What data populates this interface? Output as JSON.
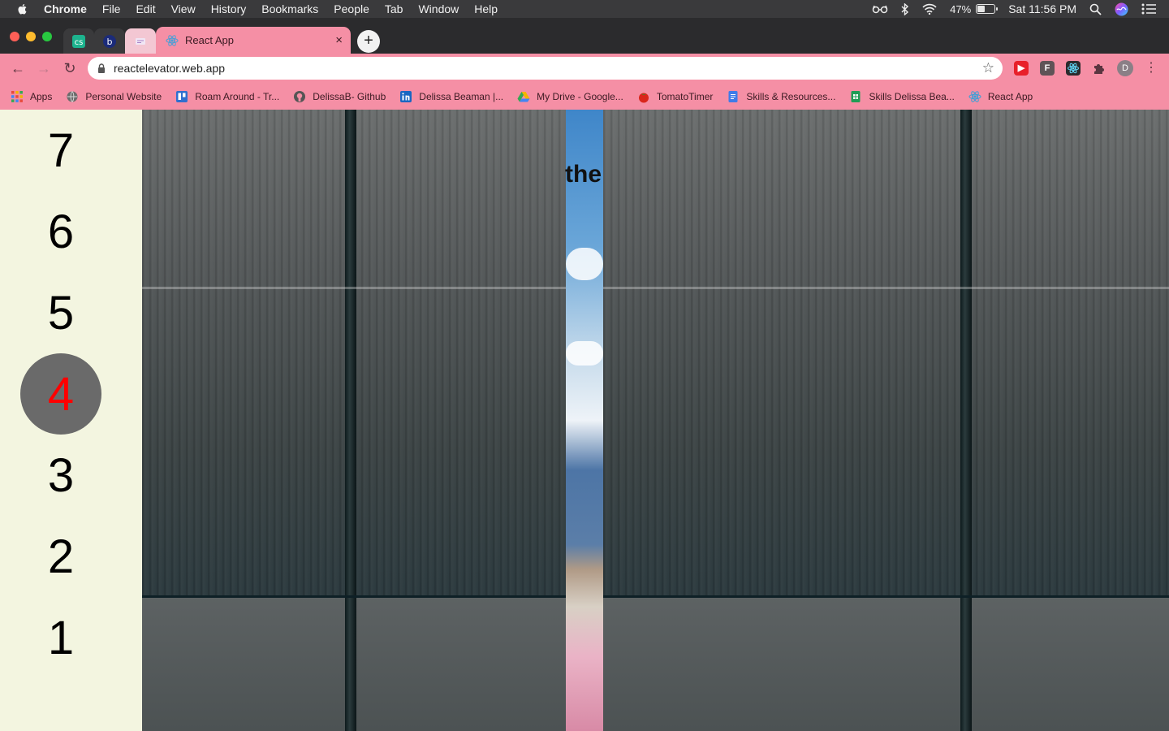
{
  "menubar": {
    "app_name": "Chrome",
    "menus": [
      "File",
      "Edit",
      "View",
      "History",
      "Bookmarks",
      "People",
      "Tab",
      "Window",
      "Help"
    ],
    "battery_percent": "47%",
    "battery_level": 0.47,
    "clock": "Sat 11:56 PM"
  },
  "tabs": {
    "active_title": "React App",
    "close_glyph": "×",
    "new_tab_glyph": "+"
  },
  "toolbar": {
    "url": "reactelevator.web.app",
    "profile_initial": "D",
    "ext_f_label": "F"
  },
  "bookmarks": [
    {
      "label": "Apps",
      "icon": "apps-grid-icon",
      "color": "#e84a3c"
    },
    {
      "label": "Personal Website",
      "icon": "globe-icon",
      "color": "#6b6b6b"
    },
    {
      "label": "Roam Around - Tr...",
      "icon": "trello-icon",
      "color": "#2f6fcf"
    },
    {
      "label": "DelissaB- Github",
      "icon": "github-icon",
      "color": "#555555"
    },
    {
      "label": "Delissa Beaman |...",
      "icon": "linkedin-icon",
      "color": "#1a66c2"
    },
    {
      "label": "My Drive - Google...",
      "icon": "google-drive-icon",
      "color": "#f4b400"
    },
    {
      "label": "TomatoTimer",
      "icon": "tomato-icon",
      "color": "#d9261c"
    },
    {
      "label": "Skills & Resources...",
      "icon": "google-docs-icon",
      "color": "#3f7be8"
    },
    {
      "label": "Skills Delissa Bea...",
      "icon": "google-sheets-icon",
      "color": "#1f9d55"
    },
    {
      "label": "React App",
      "icon": "react-icon",
      "color": "#3aa0d8"
    }
  ],
  "elevator": {
    "floors": [
      "7",
      "6",
      "5",
      "4",
      "3",
      "2",
      "1"
    ],
    "current_floor": "4",
    "door_text": "the"
  },
  "colors": {
    "chrome_pink": "#f58fa5",
    "floor_panel_bg": "#f3f5e0",
    "current_floor_bg": "#6a6a6a",
    "current_floor_text": "#ff0000"
  }
}
